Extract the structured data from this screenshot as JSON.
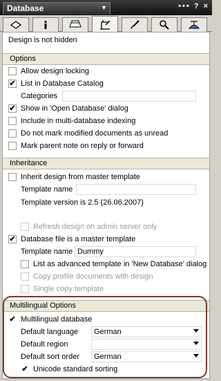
{
  "titlebar": {
    "title": "Database",
    "controls": "••• ? ×"
  },
  "tabs": [
    {
      "icon": "info-box-icon"
    },
    {
      "icon": "info-icon"
    },
    {
      "icon": "printer-icon"
    },
    {
      "icon": "design-icon"
    },
    {
      "icon": "brush-icon"
    },
    {
      "icon": "search-icon"
    },
    {
      "icon": "propeller-hat-icon"
    }
  ],
  "status": "Design is not hidden",
  "options": {
    "header": "Options",
    "allow_design_locking": "Allow design locking",
    "list_in_catalog": "List in Database Catalog",
    "categories_label": "Categories",
    "show_open_db": "Show in 'Open Database' dialog",
    "multi_db_indexing": "Include in multi-database indexing",
    "no_mark_unread": "Do not mark modified documents as unread",
    "mark_parent": "Mark parent note on reply or forward"
  },
  "inheritance": {
    "header": "Inheritance",
    "inherit_design": "Inherit design from master template",
    "template_name_label": "Template name",
    "template_version": "Template version is 2.5 (26.06.2007)",
    "refresh_design": "Refresh design on admin server only",
    "is_master": "Database file is a master template",
    "template_name_label2": "Template name",
    "template_name_value": "Dummy",
    "list_advanced": "List as advanced template in 'New Database' dialog",
    "copy_profile": "Copy profile documents with design",
    "single_copy": "Single copy template"
  },
  "multilingual": {
    "header": "Multilingual Options",
    "multilingual_db": "Multilingual database",
    "default_language_label": "Default language",
    "default_language_value": "German",
    "default_region_label": "Default region",
    "default_region_value": "",
    "default_sort_label": "Default sort order",
    "default_sort_value": "German",
    "unicode_sorting": "Unicode standard sorting"
  },
  "checkmark": "✔",
  "colors": {
    "highlight": "#7a3b2b",
    "title_bg": "#1a1a1a",
    "section_bg": "#ece9d8"
  }
}
